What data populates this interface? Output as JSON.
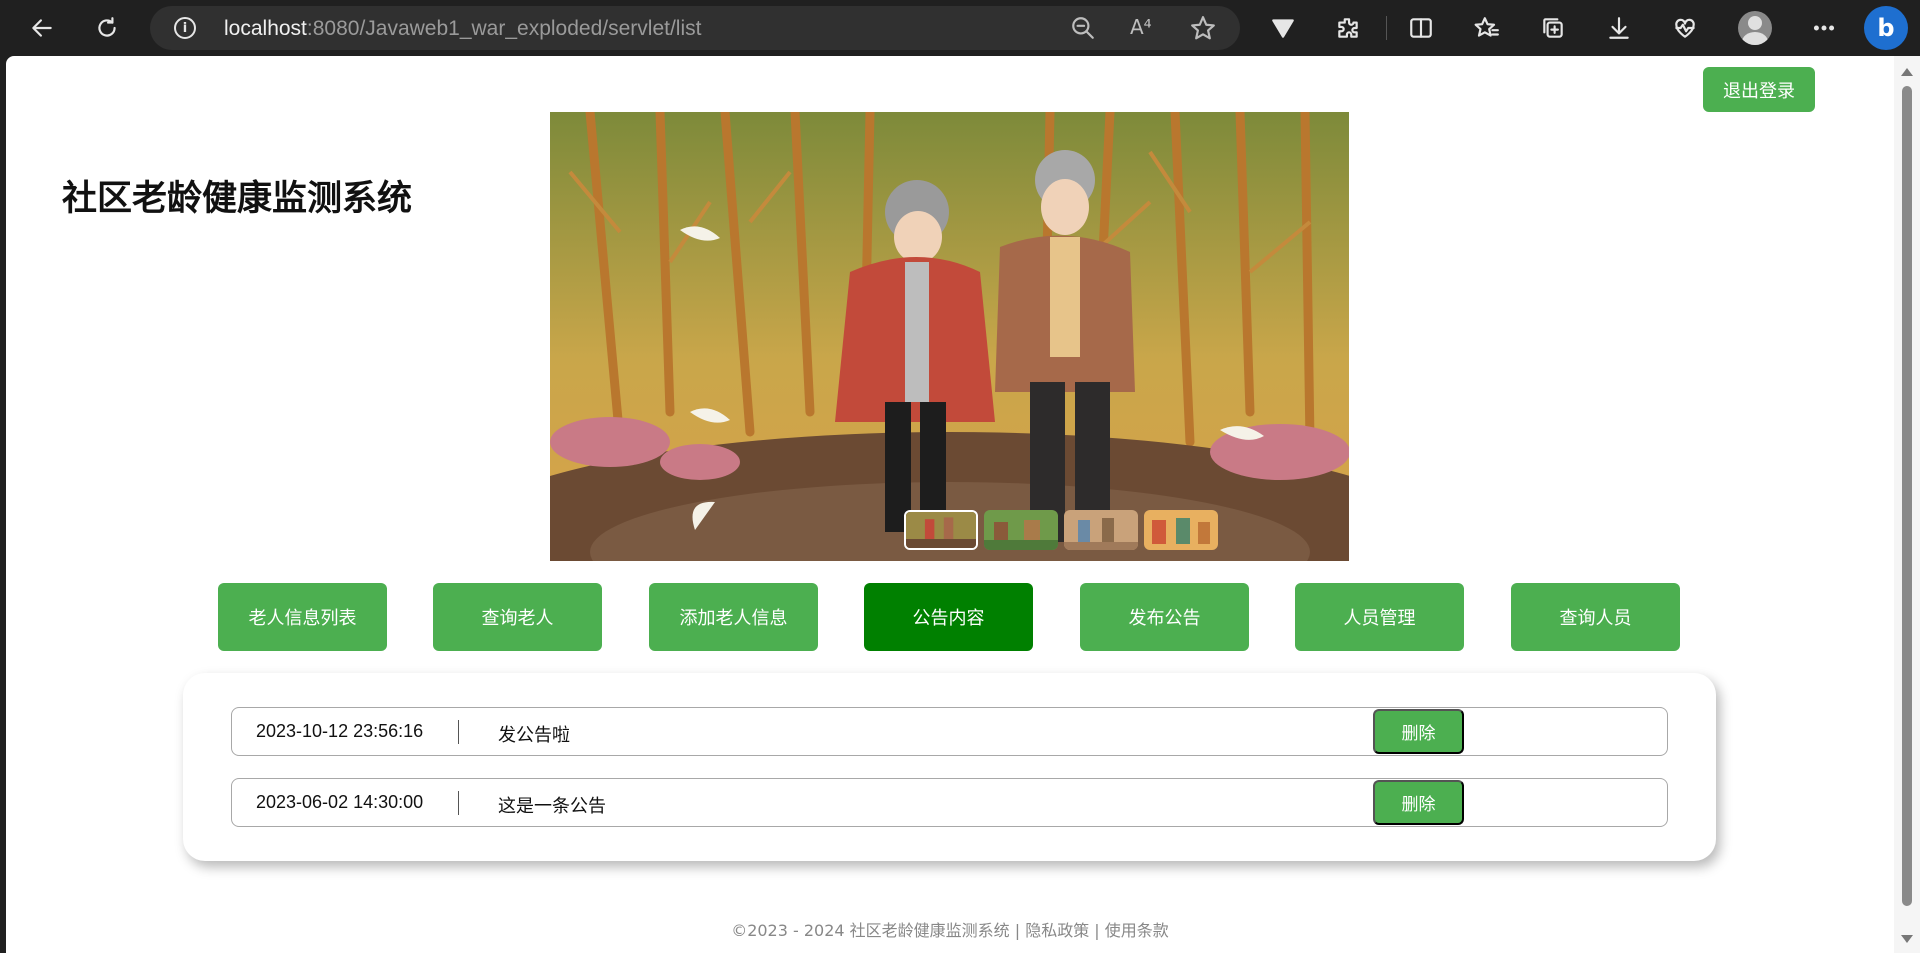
{
  "browser": {
    "url_host": "localhost",
    "url_rest": ":8080/Javaweb1_war_exploded/servlet/list",
    "icons": [
      "back-icon",
      "refresh-icon",
      "info-icon",
      "zoom-out-icon",
      "read-aloud-icon",
      "favorite-star-icon",
      "vivaldi-extension-icon",
      "extensions-icon",
      "split-screen-icon",
      "favorites-icon",
      "collections-icon",
      "downloads-icon",
      "browser-health-icon",
      "profile-avatar",
      "more-menu-icon",
      "bing-copilot-icon"
    ],
    "read_aloud_glyph": "A⁴"
  },
  "header": {
    "title": "社区老龄健康监测系统",
    "logout_label": "退出登录"
  },
  "carousel": {
    "slide_count": 4,
    "active_index": 0
  },
  "nav": {
    "items": [
      {
        "label": "老人信息列表"
      },
      {
        "label": "查询老人"
      },
      {
        "label": "添加老人信息"
      },
      {
        "label": "公告内容"
      },
      {
        "label": "发布公告"
      },
      {
        "label": "人员管理"
      },
      {
        "label": "查询人员"
      }
    ],
    "active_index": 3
  },
  "notices": [
    {
      "time": "2023-10-12 23:56:16",
      "content": "发公告啦",
      "delete_label": "删除"
    },
    {
      "time": "2023-06-02 14:30:00",
      "content": "这是一条公告",
      "delete_label": "删除"
    }
  ],
  "footer": {
    "text": "©2023 - 2024 社区老龄健康监测系统 | 隐私政策 | 使用条款"
  },
  "colors": {
    "primary_green": "#4caf50",
    "active_green": "#008000",
    "chrome_bg": "#202020"
  }
}
